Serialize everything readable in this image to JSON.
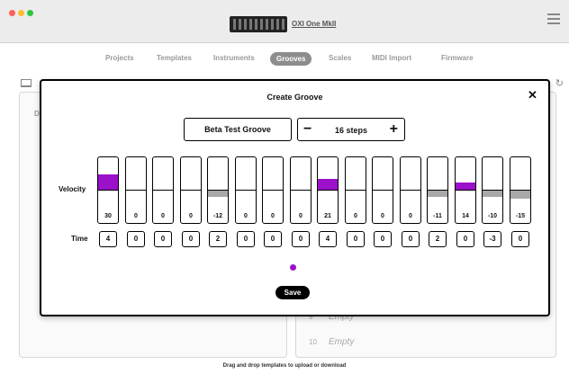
{
  "titlebar": {
    "device_name": "OXI One MkII"
  },
  "nav": {
    "items": [
      {
        "label": "Projects",
        "active": false
      },
      {
        "label": "Templates",
        "active": false
      },
      {
        "label": "Instruments",
        "active": false
      },
      {
        "label": "Grooves",
        "active": true
      },
      {
        "label": "Scales",
        "active": false
      },
      {
        "label": "MIDI Import",
        "active": false
      },
      {
        "label": "Firmware",
        "active": false
      }
    ]
  },
  "left_panel": {
    "letter": "D"
  },
  "right_panel": {
    "slots": [
      {
        "num": "9",
        "name": "Empty"
      },
      {
        "num": "10",
        "name": "Empty"
      }
    ]
  },
  "footer": {
    "text": "Drag and drop templates to upload or download"
  },
  "modal": {
    "title": "Create Groove",
    "close_label": "✕",
    "groove_name": "Beta Test Groove",
    "steps_label": "16 steps",
    "minus_label": "−",
    "plus_label": "+",
    "velocity_label": "Velocity",
    "time_label": "Time",
    "save_label": "Save",
    "velocity_range": [
      -100,
      100
    ],
    "steps": [
      {
        "velocity": "30",
        "time": "4"
      },
      {
        "velocity": "0",
        "time": "0"
      },
      {
        "velocity": "0",
        "time": "0"
      },
      {
        "velocity": "0",
        "time": "0"
      },
      {
        "velocity": "-12",
        "time": "2"
      },
      {
        "velocity": "0",
        "time": "0"
      },
      {
        "velocity": "0",
        "time": "0"
      },
      {
        "velocity": "0",
        "time": "0"
      },
      {
        "velocity": "21",
        "time": "4"
      },
      {
        "velocity": "0",
        "time": "0"
      },
      {
        "velocity": "0",
        "time": "0"
      },
      {
        "velocity": "0",
        "time": "0"
      },
      {
        "velocity": "-11",
        "time": "2"
      },
      {
        "velocity": "14",
        "time": "0"
      },
      {
        "velocity": "-10",
        "time": "-3"
      },
      {
        "velocity": "-15",
        "time": "0"
      }
    ]
  },
  "colors": {
    "positive_fill": "#9b10c9",
    "negative_fill": "#a8a8a8",
    "accent_dot": "#9b10c9"
  }
}
